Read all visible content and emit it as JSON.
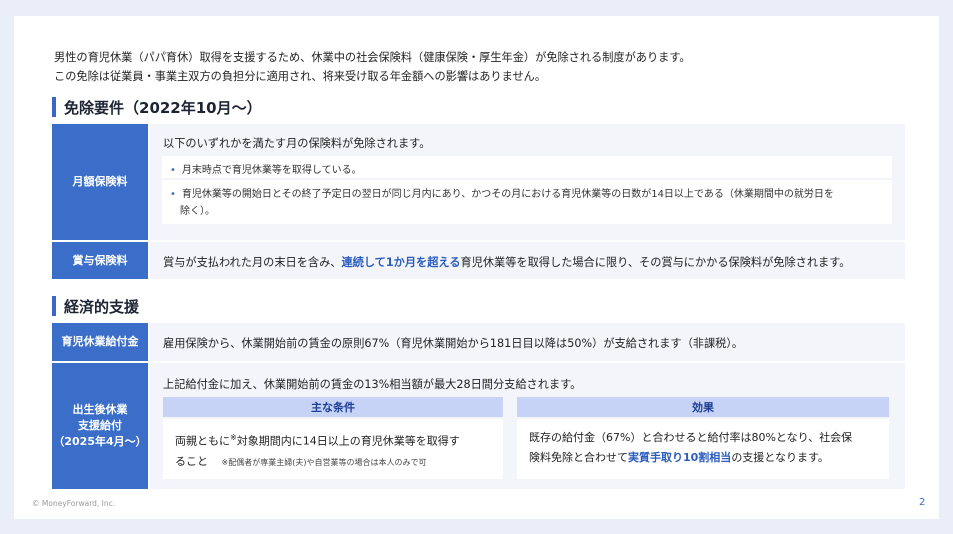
{
  "intro": {
    "line1": "男性の育児休業（パパ育休）取得を支援するため、休業中の社会保険料（健康保険・厚生年金）が免除される制度があります。",
    "line2": "この免除は従業員・事業主双方の負担分に適用され、将来受け取る年金額への影響はありません。"
  },
  "section1": {
    "title": "免除要件（2022年10月〜）",
    "monthly": {
      "label": "月額保険料",
      "lead": "以下のいずれかを満たす月の保険料が免除されます。",
      "bullet1": "月末時点で育児休業等を取得している。",
      "bullet2_line1": "育児休業等の開始日とその終了予定日の翌日が同じ月内にあり、かつその月における育児休業等の日数が14日以上である（休業期間中の就労日を",
      "bullet2_line2": "除く）。"
    },
    "bonus": {
      "label": "賞与保険料",
      "text_pre": "賞与が支払われた月の末日を含み、",
      "text_hl": "連続して1か月を超える",
      "text_post": "育児休業等を取得した場合に限り、その賞与にかかる保険料が免除されます。"
    }
  },
  "section2": {
    "title": "経済的支援",
    "childcare": {
      "label": "育児休業給付金",
      "text": "雇用保険から、休業開始前の賃金の原則67%（育児休業開始から181日目以降は50%）が支給されます（非課税）。"
    },
    "postbirth": {
      "label_line1": "出生後休業",
      "label_line2": "支援給付",
      "label_line3": "（2025年4月〜）",
      "lead": "上記給付金に加え、休業開始前の賃金の13%相当額が最大28日間分支給されます。",
      "cond_header": "主な条件",
      "cond_line1_pre": "両親ともに",
      "cond_mark": "※",
      "cond_line1_post": "対象期間内に14日以上の育児休業等を取得す",
      "cond_line2": "ること",
      "cond_note": "※配偶者が専業主婦(夫)や自営業等の場合は本人のみで可",
      "effect_header": "効果",
      "effect_line1": "既存の給付金（67%）と合わせると給付率は80%となり、社会保",
      "effect_line2_pre": "険料免除と合わせて",
      "effect_hl": "実質手取り10割相当",
      "effect_line2_post": "の支援となります。"
    }
  },
  "footer": {
    "copyright": "© MoneyForward, Inc.",
    "page": "2"
  },
  "colors": {
    "accent": "#3a6ec8",
    "header_fill": "#c6d3f7",
    "body_fill": "#f4f5fa"
  }
}
